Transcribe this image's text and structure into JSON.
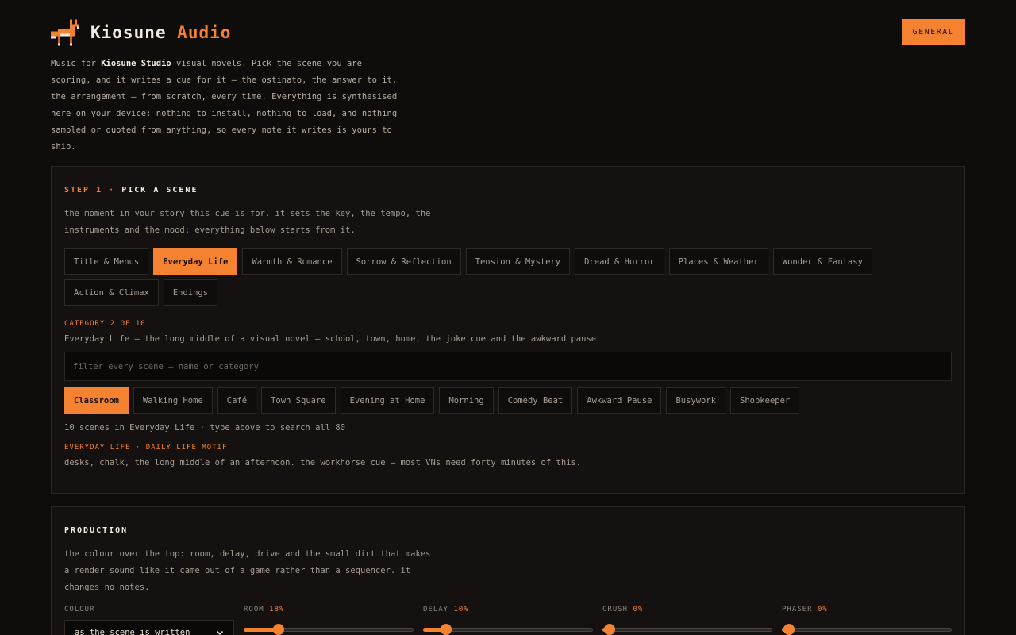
{
  "header": {
    "brand_primary": "Kiosune",
    "brand_accent": "Audio",
    "general_label": "GENERAL",
    "logo_icon": "fox-icon"
  },
  "intro": {
    "prefix": "Music for ",
    "studio": "Kiosune Studio",
    "rest": " visual novels. Pick the scene you are scoring, and it writes a cue for it – the ostinato, the answer to it, the arrangement – from scratch, every time. Everything is synthesised here on your device: nothing to install, nothing to load, and nothing sampled or quoted from anything, so every note it writes is yours to ship."
  },
  "step1": {
    "number": "STEP 1",
    "separator": "·",
    "title": "PICK A SCENE",
    "description": "the moment in your story this cue is for. it sets the key, the tempo, the instruments and the mood; everything below starts from it.",
    "categories": [
      {
        "label": "Title & Menus",
        "active": false
      },
      {
        "label": "Everyday Life",
        "active": true
      },
      {
        "label": "Warmth & Romance",
        "active": false
      },
      {
        "label": "Sorrow & Reflection",
        "active": false
      },
      {
        "label": "Tension & Mystery",
        "active": false
      },
      {
        "label": "Dread & Horror",
        "active": false
      },
      {
        "label": "Places & Weather",
        "active": false
      },
      {
        "label": "Wonder & Fantasy",
        "active": false
      },
      {
        "label": "Action & Climax",
        "active": false
      },
      {
        "label": "Endings",
        "active": false
      }
    ],
    "category_index": "CATEGORY 2 OF 10",
    "category_description": "Everyday Life – the long middle of a visual novel – school, town, home, the joke cue and the awkward pause",
    "filter_placeholder": "filter every scene – name or category",
    "scenes": [
      {
        "label": "Classroom",
        "active": true
      },
      {
        "label": "Walking Home",
        "active": false
      },
      {
        "label": "Café",
        "active": false
      },
      {
        "label": "Town Square",
        "active": false
      },
      {
        "label": "Evening at Home",
        "active": false
      },
      {
        "label": "Morning",
        "active": false
      },
      {
        "label": "Comedy Beat",
        "active": false
      },
      {
        "label": "Awkward Pause",
        "active": false
      },
      {
        "label": "Busywork",
        "active": false
      },
      {
        "label": "Shopkeeper",
        "active": false
      }
    ],
    "scene_count": "10 scenes in Everyday Life · type above to search all 80",
    "motif": "EVERYDAY LIFE · DAILY LIFE MOTIF",
    "scene_description": "desks, chalk, the long middle of an afternoon. the workhorse cue – most VNs need forty minutes of this."
  },
  "production": {
    "title": "PRODUCTION",
    "description": "the colour over the top: room, delay, drive and the small dirt that makes a render sound like it came out of a game rather than a sequencer. it changes no notes.",
    "colour_label": "COLOUR",
    "colour_value": "as the scene is written",
    "sliders": [
      {
        "label": "ROOM",
        "value_text": "18%",
        "value": 0.18
      },
      {
        "label": "DELAY",
        "value_text": "10%",
        "value": 0.1
      },
      {
        "label": "CRUSH",
        "value_text": "0%",
        "value": 0.0
      },
      {
        "label": "PHASER",
        "value_text": "0%",
        "value": 0.0
      }
    ]
  },
  "colors": {
    "accent": "#f58230",
    "background": "#0f0d0c",
    "card": "#141110"
  }
}
